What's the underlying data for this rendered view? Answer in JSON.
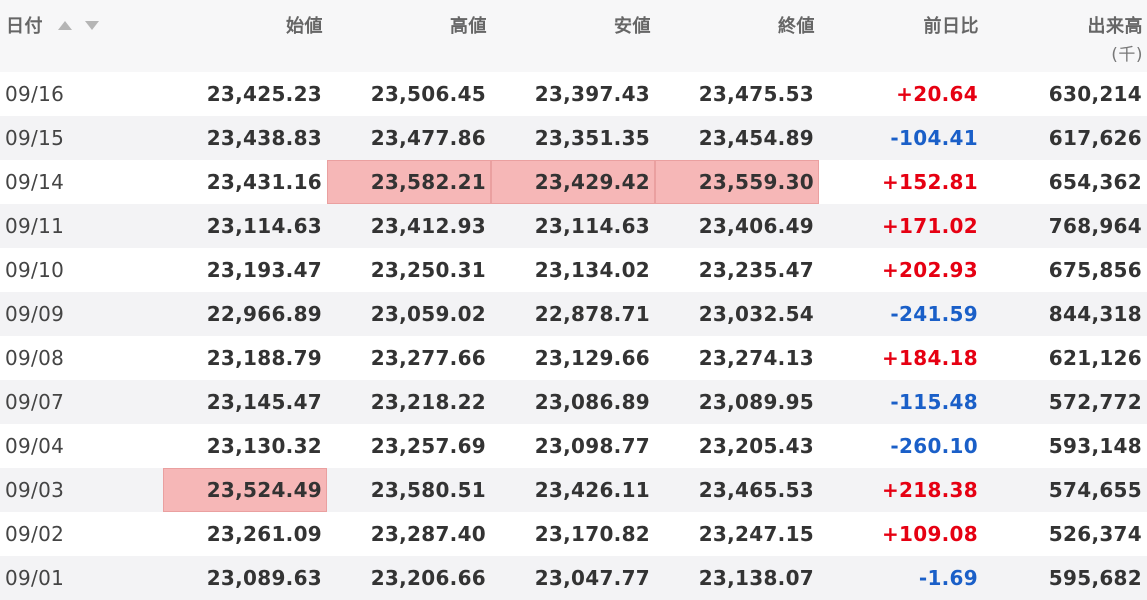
{
  "header": {
    "date": "日付",
    "open": "始値",
    "high": "高値",
    "low": "安値",
    "close": "終値",
    "change": "前日比",
    "volume": "出来高",
    "volume_unit": "(千)",
    "sort_icons": [
      "sort-ascending-icon",
      "sort-descending-icon"
    ]
  },
  "colors": {
    "up": "#e60012",
    "down": "#1a5fc8",
    "highlight": "#f6b7b7",
    "stripe": "#f3f3f5"
  },
  "rows": [
    {
      "date": "09/16",
      "open": "23,425.23",
      "high": "23,506.45",
      "low": "23,397.43",
      "close": "23,475.53",
      "change": "+20.64",
      "volume": "630,214",
      "dir": "up",
      "highlight": []
    },
    {
      "date": "09/15",
      "open": "23,438.83",
      "high": "23,477.86",
      "low": "23,351.35",
      "close": "23,454.89",
      "change": "-104.41",
      "volume": "617,626",
      "dir": "down",
      "highlight": []
    },
    {
      "date": "09/14",
      "open": "23,431.16",
      "high": "23,582.21",
      "low": "23,429.42",
      "close": "23,559.30",
      "change": "+152.81",
      "volume": "654,362",
      "dir": "up",
      "highlight": [
        "high",
        "low",
        "close"
      ]
    },
    {
      "date": "09/11",
      "open": "23,114.63",
      "high": "23,412.93",
      "low": "23,114.63",
      "close": "23,406.49",
      "change": "+171.02",
      "volume": "768,964",
      "dir": "up",
      "highlight": []
    },
    {
      "date": "09/10",
      "open": "23,193.47",
      "high": "23,250.31",
      "low": "23,134.02",
      "close": "23,235.47",
      "change": "+202.93",
      "volume": "675,856",
      "dir": "up",
      "highlight": []
    },
    {
      "date": "09/09",
      "open": "22,966.89",
      "high": "23,059.02",
      "low": "22,878.71",
      "close": "23,032.54",
      "change": "-241.59",
      "volume": "844,318",
      "dir": "down",
      "highlight": []
    },
    {
      "date": "09/08",
      "open": "23,188.79",
      "high": "23,277.66",
      "low": "23,129.66",
      "close": "23,274.13",
      "change": "+184.18",
      "volume": "621,126",
      "dir": "up",
      "highlight": []
    },
    {
      "date": "09/07",
      "open": "23,145.47",
      "high": "23,218.22",
      "low": "23,086.89",
      "close": "23,089.95",
      "change": "-115.48",
      "volume": "572,772",
      "dir": "down",
      "highlight": []
    },
    {
      "date": "09/04",
      "open": "23,130.32",
      "high": "23,257.69",
      "low": "23,098.77",
      "close": "23,205.43",
      "change": "-260.10",
      "volume": "593,148",
      "dir": "down",
      "highlight": []
    },
    {
      "date": "09/03",
      "open": "23,524.49",
      "high": "23,580.51",
      "low": "23,426.11",
      "close": "23,465.53",
      "change": "+218.38",
      "volume": "574,655",
      "dir": "up",
      "highlight": [
        "open"
      ]
    },
    {
      "date": "09/02",
      "open": "23,261.09",
      "high": "23,287.40",
      "low": "23,170.82",
      "close": "23,247.15",
      "change": "+109.08",
      "volume": "526,374",
      "dir": "up",
      "highlight": []
    },
    {
      "date": "09/01",
      "open": "23,089.63",
      "high": "23,206.66",
      "low": "23,047.77",
      "close": "23,138.07",
      "change": "-1.69",
      "volume": "595,682",
      "dir": "down",
      "highlight": []
    }
  ]
}
